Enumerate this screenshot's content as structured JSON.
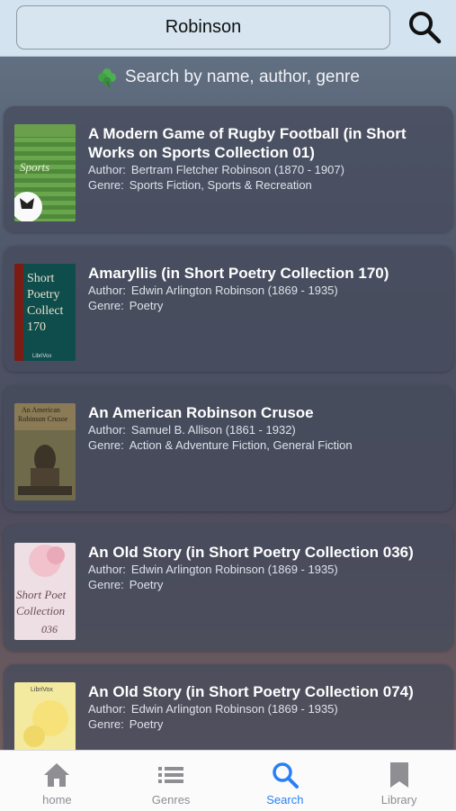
{
  "search": {
    "value": "Robinson"
  },
  "hint": {
    "text": "Search by name, author, genre"
  },
  "author_label": "Author:",
  "genre_label": "Genre:",
  "results": [
    {
      "title": "A Modern Game of Rugby Football (in Short Works on Sports Collection 01)",
      "author": "Bertram Fletcher Robinson (1870 - 1907)",
      "genre": "Sports Fiction, Sports & Recreation",
      "cover_text": "Sports"
    },
    {
      "title": "Amaryllis (in  Short Poetry Collection 170)",
      "author": "Edwin Arlington Robinson (1869 - 1935)",
      "genre": "Poetry",
      "cover_text": "Short Poetry Collect 170"
    },
    {
      "title": "An American Robinson Crusoe",
      "author": "Samuel B. Allison (1861 - 1932)",
      "genre": "Action & Adventure Fiction, General Fiction",
      "cover_text": "An American Robinson Crusoe"
    },
    {
      "title": "An Old Story (in  Short Poetry Collection 036)",
      "author": "Edwin Arlington Robinson (1869 - 1935)",
      "genre": "Poetry",
      "cover_text": "Short Poetry Collection 036"
    },
    {
      "title": "An Old Story (in  Short Poetry Collection 074)",
      "author": "Edwin Arlington Robinson (1869 - 1935)",
      "genre": "Poetry",
      "cover_text": "LibriVox"
    }
  ],
  "tabs": [
    {
      "label": "home",
      "icon": "home-icon",
      "active": false
    },
    {
      "label": "Genres",
      "icon": "list-icon",
      "active": false
    },
    {
      "label": "Search",
      "icon": "search-icon",
      "active": true
    },
    {
      "label": "Library",
      "icon": "bookmark-icon",
      "active": false
    }
  ],
  "colors": {
    "accent": "#2a7ff6",
    "inactive_tab": "#8e8e93",
    "topbar": "#d3e3ef"
  }
}
